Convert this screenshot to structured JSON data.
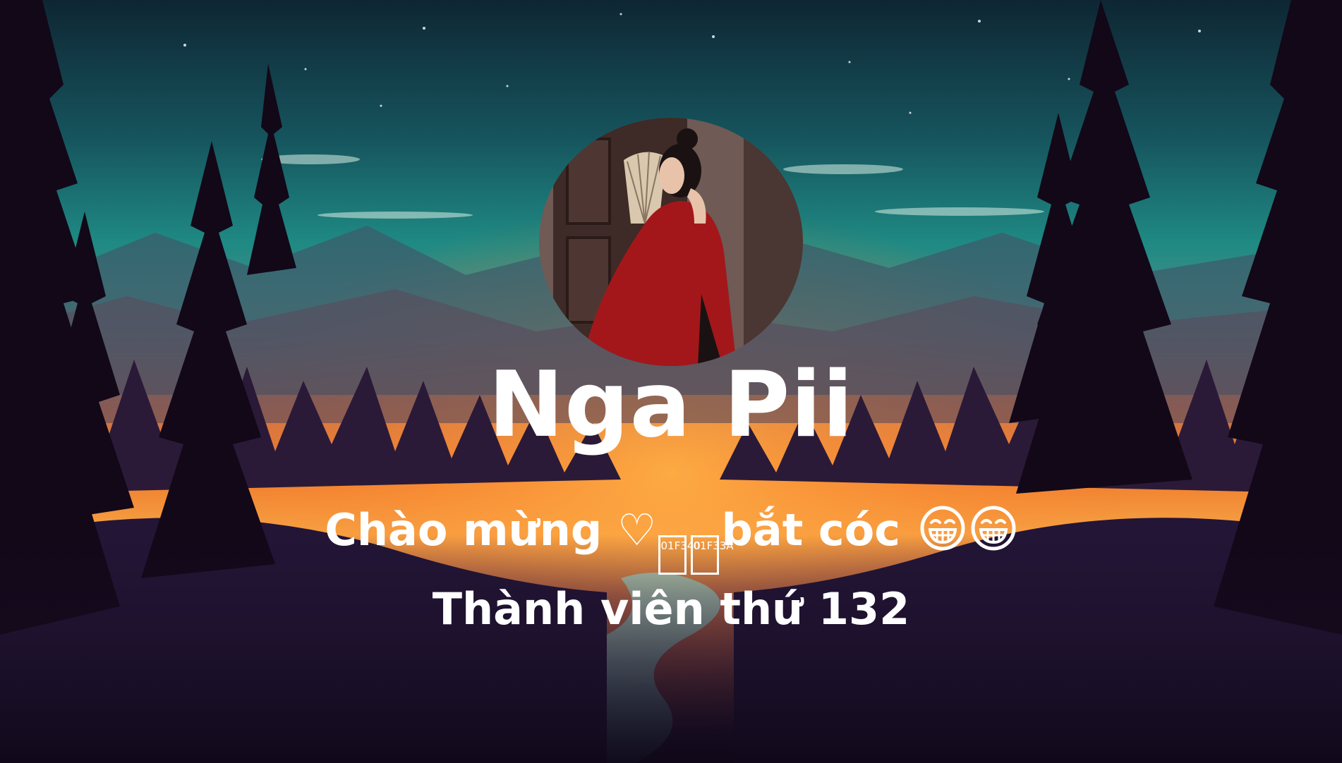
{
  "colors": {
    "sky_top": "#0f2a3a",
    "sky_teal": "#1f8f86",
    "horizon_orange": "#f0782a",
    "forest_dark": "#140a1e",
    "text": "#ffffff"
  },
  "profile": {
    "avatar_icon": "profile-photo-woman-red-ao-dai-with-fan",
    "name": "Nga Pii"
  },
  "welcome": {
    "text_before": "Chào mừng ♡",
    "missing_glyph_1": "01F340",
    "missing_glyph_2": "01F33A",
    "text_after": "bắt cóc ",
    "emoji_icon": "laughing-face-icon"
  },
  "member": {
    "text": "Thành viên thứ  132"
  }
}
